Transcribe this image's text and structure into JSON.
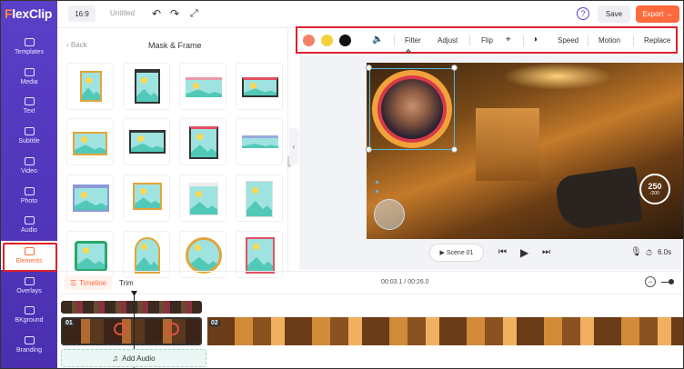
{
  "app": {
    "logo": "FlexClip"
  },
  "sidebar": {
    "items": [
      {
        "label": "Templates",
        "icon": "templates-icon"
      },
      {
        "label": "Media",
        "icon": "media-icon"
      },
      {
        "label": "Text",
        "icon": "text-icon"
      },
      {
        "label": "Subtitle",
        "icon": "subtitle-icon"
      },
      {
        "label": "Video",
        "icon": "video-icon"
      },
      {
        "label": "Photo",
        "icon": "photo-icon"
      },
      {
        "label": "Audio",
        "icon": "audio-icon"
      },
      {
        "label": "Elements",
        "icon": "elements-icon",
        "active": true
      },
      {
        "label": "Overlays",
        "icon": "overlays-icon"
      },
      {
        "label": "BKground",
        "icon": "background-icon"
      },
      {
        "label": "Branding",
        "icon": "branding-icon"
      }
    ]
  },
  "topbar": {
    "aspect_ratio": "16:9",
    "doc_title": "Untitled",
    "save_label": "Save",
    "export_label": "Export →"
  },
  "panel": {
    "back_label": "Back",
    "title": "Mask & Frame"
  },
  "toolbar": {
    "colors": [
      "#f28266",
      "#f2d13c",
      "#111111"
    ],
    "filter_label": "Filter",
    "adjust_label": "Adjust",
    "flip_label": "Flip",
    "speed_label": "Speed",
    "motion_label": "Motion",
    "replace_label": "Replace"
  },
  "preview": {
    "speed_value": "250",
    "speed_unit": "/200"
  },
  "playback": {
    "scene_label": "Scene 01",
    "duration": "6.0s"
  },
  "timeline": {
    "tab_label": "Timeline",
    "trim_label": "Trim",
    "timecode": "00:03.1 / 00:26.0",
    "clip1_badge": "01",
    "clip2_badge": "02",
    "add_audio_label": "Add Audio"
  },
  "colors": {
    "accent": "#5a3fc8",
    "brand_orange": "#ff6a3d",
    "highlight_red": "#e0202a"
  }
}
